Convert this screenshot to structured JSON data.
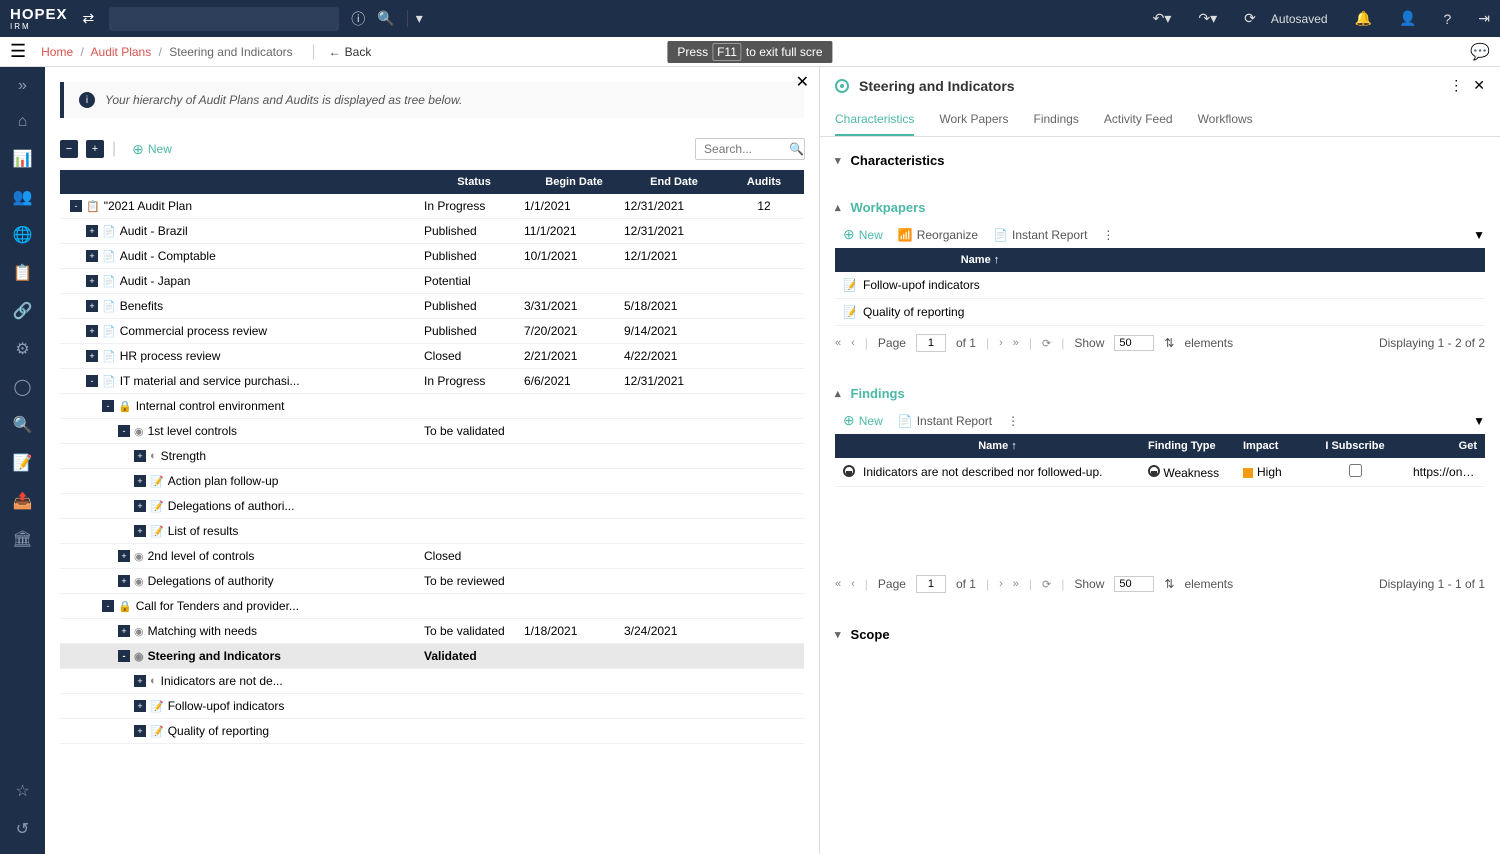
{
  "header": {
    "logo": "HOPEX",
    "logo_sub": "IRM",
    "autosaved": "Autosaved"
  },
  "breadcrumb": {
    "home": "Home",
    "audit_plans": "Audit Plans",
    "current": "Steering and Indicators",
    "back": "Back"
  },
  "fullscreen": {
    "press": "Press",
    "key": "F11",
    "rest": "to exit full scre"
  },
  "left": {
    "info": "Your hierarchy of Audit Plans and Audits is displayed as tree below.",
    "new": "New",
    "search_placeholder": "Search...",
    "headers": {
      "status": "Status",
      "begin": "Begin Date",
      "end": "End Date",
      "audits": "Audits"
    },
    "rows": [
      {
        "indent": 0,
        "exp": "-",
        "icon": "📋",
        "name": "\"2021 Audit Plan",
        "status": "In Progress",
        "begin": "1/1/2021",
        "end": "12/31/2021",
        "audits": "12"
      },
      {
        "indent": 1,
        "exp": "+",
        "icon": "📄",
        "name": "Audit - Brazil",
        "status": "Published",
        "begin": "11/1/2021",
        "end": "12/31/2021",
        "audits": ""
      },
      {
        "indent": 1,
        "exp": "+",
        "icon": "📄",
        "name": "Audit - Comptable",
        "status": "Published",
        "begin": "10/1/2021",
        "end": "12/1/2021",
        "audits": ""
      },
      {
        "indent": 1,
        "exp": "+",
        "icon": "📄",
        "name": "Audit - Japan",
        "status": "Potential",
        "begin": "",
        "end": "",
        "audits": ""
      },
      {
        "indent": 1,
        "exp": "+",
        "icon": "📄",
        "name": "Benefits",
        "status": "Published",
        "begin": "3/31/2021",
        "end": "5/18/2021",
        "audits": ""
      },
      {
        "indent": 1,
        "exp": "+",
        "icon": "📄",
        "name": "Commercial process review",
        "status": "Published",
        "begin": "7/20/2021",
        "end": "9/14/2021",
        "audits": ""
      },
      {
        "indent": 1,
        "exp": "+",
        "icon": "📄",
        "name": "HR process review",
        "status": "Closed",
        "begin": "2/21/2021",
        "end": "4/22/2021",
        "audits": ""
      },
      {
        "indent": 1,
        "exp": "-",
        "icon": "📄",
        "name": "IT material and service purchasi...",
        "status": "In Progress",
        "begin": "6/6/2021",
        "end": "12/31/2021",
        "audits": ""
      },
      {
        "indent": 2,
        "exp": "-",
        "icon": "🔒",
        "name": "Internal control environment",
        "status": "",
        "begin": "",
        "end": "",
        "audits": ""
      },
      {
        "indent": 3,
        "exp": "-",
        "icon": "◉",
        "name": "1st level controls",
        "status": "To be validated",
        "begin": "",
        "end": "",
        "audits": ""
      },
      {
        "indent": 4,
        "exp": "+",
        "icon": "◐",
        "name": "Strength",
        "status": "",
        "begin": "",
        "end": "",
        "audits": ""
      },
      {
        "indent": 4,
        "exp": "+",
        "icon": "📝",
        "name": "Action plan follow-up",
        "status": "",
        "begin": "",
        "end": "",
        "audits": ""
      },
      {
        "indent": 4,
        "exp": "+",
        "icon": "📝",
        "name": "Delegations of authori...",
        "status": "",
        "begin": "",
        "end": "",
        "audits": ""
      },
      {
        "indent": 4,
        "exp": "+",
        "icon": "📝",
        "name": "List of results",
        "status": "",
        "begin": "",
        "end": "",
        "audits": ""
      },
      {
        "indent": 3,
        "exp": "+",
        "icon": "◉",
        "name": "2nd level of controls",
        "status": "Closed",
        "begin": "",
        "end": "",
        "audits": ""
      },
      {
        "indent": 3,
        "exp": "+",
        "icon": "◉",
        "name": "Delegations of authority",
        "status": "To be reviewed",
        "begin": "",
        "end": "",
        "audits": ""
      },
      {
        "indent": 2,
        "exp": "-",
        "icon": "🔒",
        "name": "Call for Tenders and provider...",
        "status": "",
        "begin": "",
        "end": "",
        "audits": ""
      },
      {
        "indent": 3,
        "exp": "+",
        "icon": "◉",
        "name": "Matching with needs",
        "status": "To be validated",
        "begin": "1/18/2021",
        "end": "3/24/2021",
        "audits": ""
      },
      {
        "indent": 3,
        "exp": "-",
        "icon": "◉",
        "name": "Steering and Indicators",
        "status": "Validated",
        "begin": "",
        "end": "",
        "audits": "",
        "selected": true
      },
      {
        "indent": 4,
        "exp": "+",
        "icon": "◐",
        "name": "Inidicators are not de...",
        "status": "",
        "begin": "",
        "end": "",
        "audits": ""
      },
      {
        "indent": 4,
        "exp": "+",
        "icon": "📝",
        "name": "Follow-upof indicators",
        "status": "",
        "begin": "",
        "end": "",
        "audits": ""
      },
      {
        "indent": 4,
        "exp": "+",
        "icon": "📝",
        "name": "Quality of reporting",
        "status": "",
        "begin": "",
        "end": "",
        "audits": ""
      }
    ]
  },
  "right": {
    "title": "Steering and Indicators",
    "tabs": [
      "Characteristics",
      "Work Papers",
      "Findings",
      "Activity Feed",
      "Workflows"
    ],
    "sections": {
      "characteristics": "Characteristics",
      "workpapers": "Workpapers",
      "findings": "Findings",
      "scope": "Scope"
    },
    "wp_toolbar": {
      "new": "New",
      "reorganize": "Reorganize",
      "instant": "Instant Report"
    },
    "wp_header": {
      "name": "Name"
    },
    "wp_rows": [
      {
        "name": "Follow-upof indicators"
      },
      {
        "name": "Quality of reporting"
      }
    ],
    "find_toolbar": {
      "new": "New",
      "instant": "Instant Report"
    },
    "find_header": {
      "name": "Name",
      "type": "Finding Type",
      "impact": "Impact",
      "subscribe": "I Subscribe",
      "get": "Get"
    },
    "find_rows": [
      {
        "name": "Inidicators are not described nor followed-up.",
        "type": "Weakness",
        "impact": "High",
        "url": "https://one.demo"
      }
    ],
    "pagination": {
      "page": "Page",
      "page_num": "1",
      "of": "of 1",
      "show": "Show",
      "per": "50",
      "elements": "elements",
      "display_wp": "Displaying 1 - 2 of 2",
      "display_f": "Displaying 1 - 1 of 1"
    }
  }
}
